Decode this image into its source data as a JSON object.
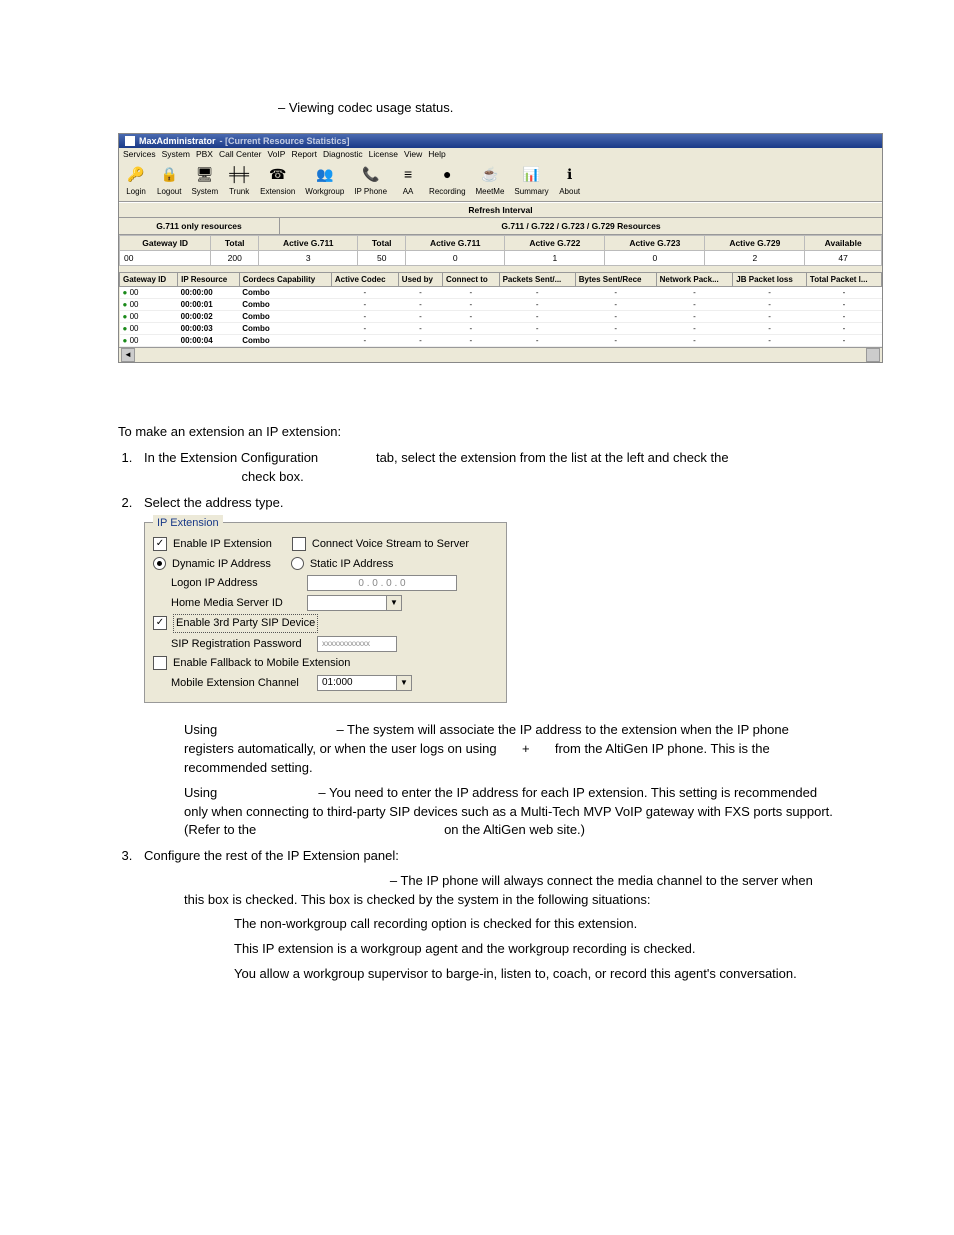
{
  "intro_line": "– Viewing codec usage status.",
  "app": {
    "title": "MaxAdministrator",
    "subtitle": "- [Current Resource Statistics]",
    "menu": [
      "Services",
      "System",
      "PBX",
      "Call Center",
      "VoIP",
      "Report",
      "Diagnostic",
      "License",
      "View",
      "Help"
    ],
    "toolbar": [
      {
        "name": "login",
        "label": "Login",
        "glyph": "🔑"
      },
      {
        "name": "logout",
        "label": "Logout",
        "glyph": "🔒"
      },
      {
        "name": "system",
        "label": "System",
        "glyph": "🖥"
      },
      {
        "name": "trunk",
        "label": "Trunk",
        "glyph": "╪╪"
      },
      {
        "name": "extension",
        "label": "Extension",
        "glyph": "☎"
      },
      {
        "name": "workgroup",
        "label": "Workgroup",
        "glyph": "👥"
      },
      {
        "name": "ipphone",
        "label": "IP Phone",
        "glyph": "📞"
      },
      {
        "name": "aa",
        "label": "AA",
        "glyph": "≡"
      },
      {
        "name": "recording",
        "label": "Recording",
        "glyph": "●"
      },
      {
        "name": "meetme",
        "label": "MeetMe",
        "glyph": "☕"
      },
      {
        "name": "summary",
        "label": "Summary",
        "glyph": "📊"
      },
      {
        "name": "about",
        "label": "About",
        "glyph": "ℹ"
      }
    ],
    "refresh_label": "Refresh Interval",
    "left_title": "G.711 only resources",
    "right_title": "G.711 / G.722 / G.723 / G.729 Resources",
    "gw_label": "Gateway ID",
    "left_cols": [
      "Total",
      "Active G.711"
    ],
    "right_cols": [
      "Total",
      "Active G.711",
      "Active G.722",
      "Active G.723",
      "Active G.729",
      "Available"
    ],
    "summary_row": {
      "gw": "00",
      "left": [
        "200",
        "3"
      ],
      "right": [
        "50",
        "0",
        "1",
        "0",
        "2",
        "47"
      ]
    },
    "det_cols": [
      "Gateway ID",
      "IP Resource",
      "Cordecs Capability",
      "Active Codec",
      "Used by",
      "Connect to",
      "Packets Sent/...",
      "Bytes Sent/Rece",
      "Network Pack...",
      "JB Packet loss",
      "Total Packet l..."
    ],
    "det_rows": [
      {
        "gw": "00",
        "ip": "00:00:00",
        "cap": "Combo"
      },
      {
        "gw": "00",
        "ip": "00:00:01",
        "cap": "Combo"
      },
      {
        "gw": "00",
        "ip": "00:00:02",
        "cap": "Combo"
      },
      {
        "gw": "00",
        "ip": "00:00:03",
        "cap": "Combo"
      },
      {
        "gw": "00",
        "ip": "00:00:04",
        "cap": "Combo"
      }
    ]
  },
  "text": {
    "make_ext": "To make an extension an IP extension:",
    "step1a": "In the Extension Configuration",
    "step1b": "tab, select the extension from the list at the left and check the",
    "step1c": "check box.",
    "step2": "Select the address type.",
    "using_dyn": " – The system will associate the IP address to the extension when the IP phone registers automatically, or when the user logs on using ",
    "using_dyn2": " from the AltiGen IP phone. This is the recommended setting.",
    "plus": " + ",
    "using_stat": " – You need to enter the IP address for each IP extension. This setting is recommended only when connecting to third-party SIP devices such as a Multi-Tech MVP VoIP gateway with FXS ports support. (Refer to the ",
    "using_stat2": " on the AltiGen web site.)",
    "step3": "Configure the rest of the IP Extension panel:",
    "cvs": " – The IP phone will always connect the media channel to the server when this box is checked. This box is checked by the system in the following situations:",
    "b1": "The non-workgroup call recording option is checked for this extension.",
    "b2": "This IP extension is a workgroup agent and the workgroup recording is checked.",
    "b3": "You allow a workgroup supervisor to barge-in, listen to, coach, or record this agent's conversation.",
    "using": "Using"
  },
  "panel": {
    "legend": "IP Extension",
    "enable_ip": "Enable IP Extension",
    "connect_vs": "Connect Voice Stream to Server",
    "dyn": "Dynamic IP Address",
    "stat": "Static IP Address",
    "logon": "Logon IP Address",
    "ip_val": "0   .   0   .   0   .   0",
    "home": "Home Media Server ID",
    "third": "Enable 3rd Party SIP Device",
    "sip_pw": "SIP Registration Password",
    "sip_pw_val": "xxxxxxxxxxxx",
    "fallback": "Enable Fallback to Mobile Extension",
    "mobile": "Mobile Extension Channel",
    "mobile_val": "01:000"
  }
}
